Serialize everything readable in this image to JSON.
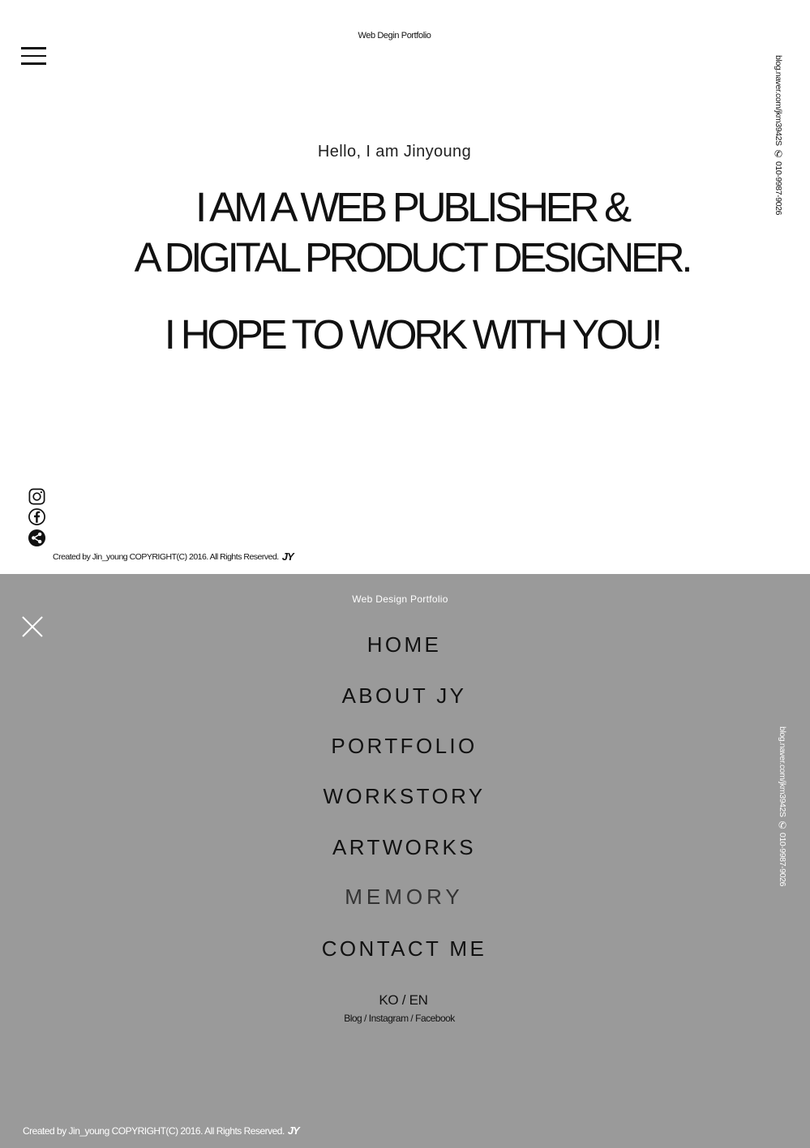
{
  "top": {
    "site_title": "Web Degin Portfolio",
    "side_contact": {
      "blog": "blog.naver.com/jkm3942S",
      "phone": "010-9987-9026"
    },
    "hello": "Hello, I am Jinyoung",
    "headline": {
      "line1": "I AM A  WEB PUBLISHER &",
      "line2": "A DIGITAL PRODUCT DESIGNER.",
      "line3": "I HOPE TO WORK WITH YOU!"
    },
    "social_icons": [
      "instagram-icon",
      "facebook-icon",
      "share-icon"
    ],
    "copyright": "Created by Jin_young COPYRIGHT(C) 2016. All Rights Reserved.",
    "logo_text": "JY"
  },
  "menu": {
    "site_title": "Web  Design  Portfolio",
    "items": [
      {
        "label": "HOME"
      },
      {
        "label": "ABOUT JY"
      },
      {
        "label": "PORTFOLIO"
      },
      {
        "label": "WORKSTORY"
      },
      {
        "label": "ARTWORKS"
      },
      {
        "label": "MEMORY"
      },
      {
        "label": "CONTACT ME"
      }
    ],
    "side_contact": {
      "blog": "blog.naver.com/jkm3942S",
      "phone": "010-9987-9026"
    },
    "lang": {
      "ko": "KO",
      "sep": "/",
      "en": "EN"
    },
    "sns": {
      "blog": "Blog",
      "instagram": "Instagram",
      "facebook": "Facebook",
      "sep": " / "
    },
    "copyright": "Created by Jin_young COPYRIGHT(C) 2016. All Rights Reserved.",
    "logo_text": "JY"
  },
  "colors": {
    "menu_bg": "#9a9a9a",
    "page_bg": "#ffffff",
    "text": "#111111"
  }
}
